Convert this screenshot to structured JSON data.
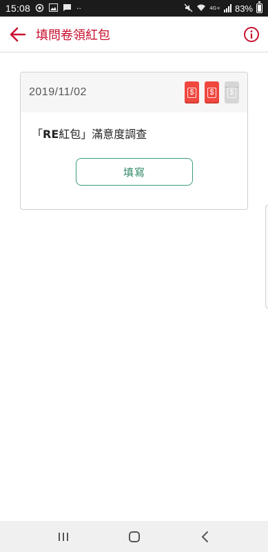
{
  "status_bar": {
    "time": "15:08",
    "battery": "83%",
    "network": "4G+"
  },
  "app_bar": {
    "title": "填問卷領紅包",
    "accent_color": "#c8102e"
  },
  "card": {
    "date": "2019/11/02",
    "envelopes": [
      {
        "state": "active",
        "symbol": "$"
      },
      {
        "state": "active",
        "symbol": "$"
      },
      {
        "state": "inactive",
        "symbol": "$"
      }
    ],
    "survey_title_prefix": "「",
    "survey_title_brand": "RE",
    "survey_title_rest": "紅包」滿意度調查",
    "fill_button_label": "填寫",
    "button_color": "#3a9b78"
  },
  "nav": {
    "recents_icon": "recents-icon",
    "home_icon": "home-icon",
    "back_icon": "back-icon"
  }
}
